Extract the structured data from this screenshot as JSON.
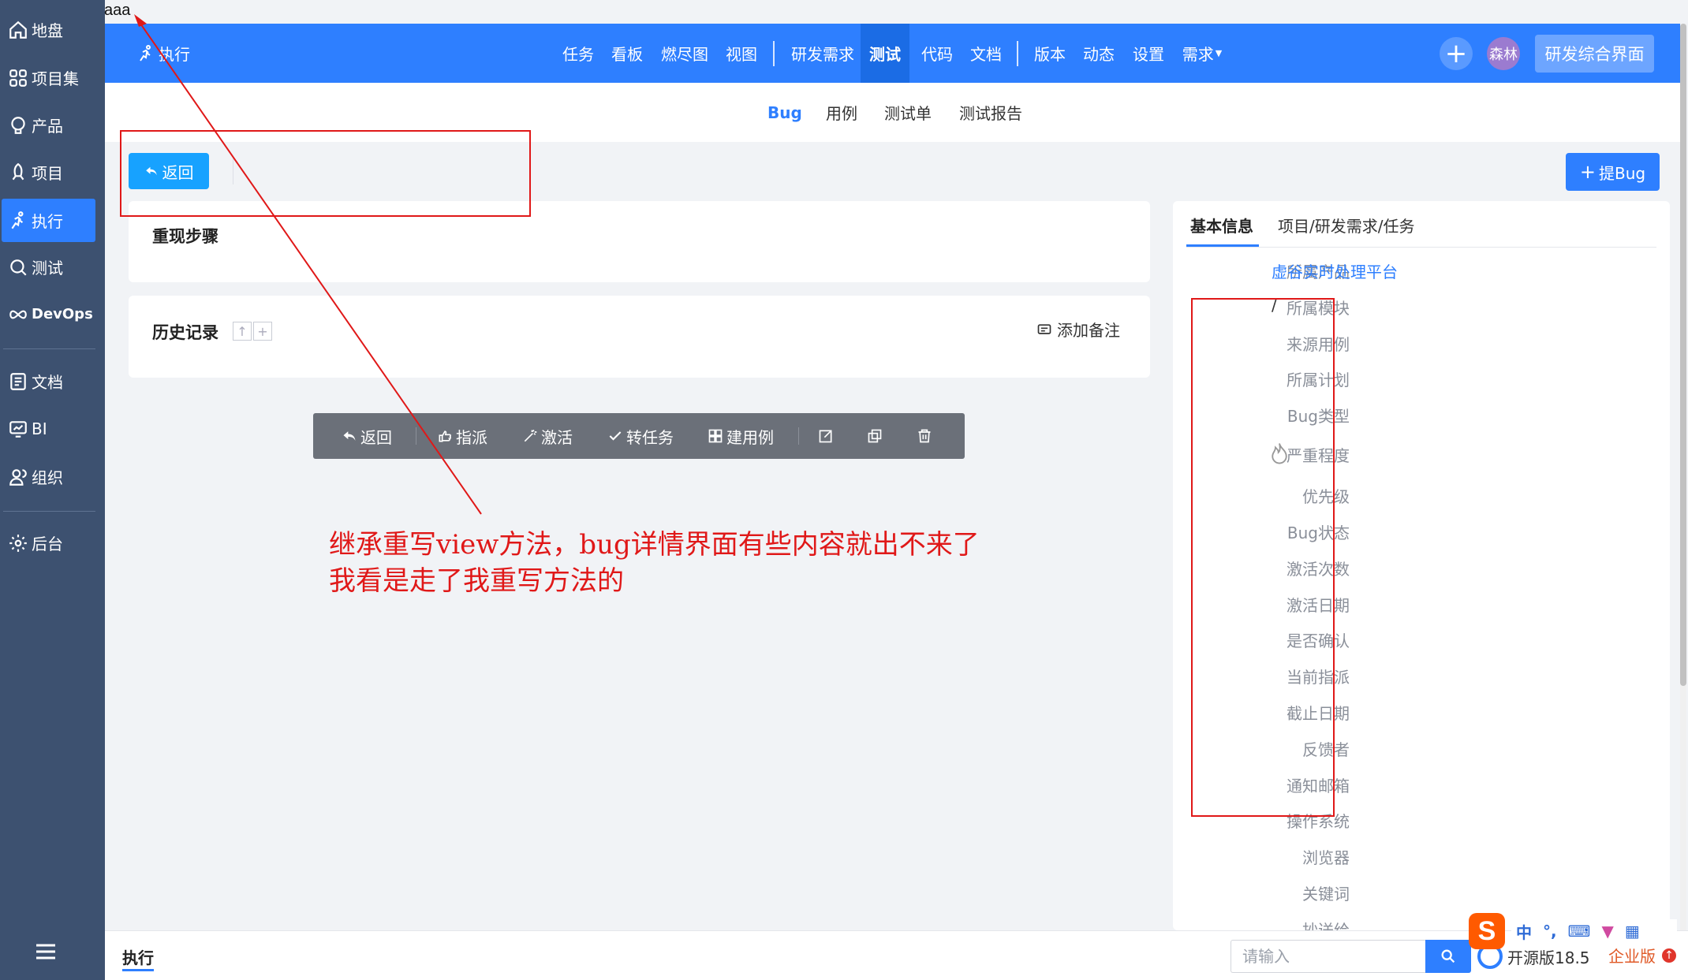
{
  "top_note": "aaa",
  "sidebar": {
    "items": [
      {
        "label": "地盘",
        "icon": "home-icon"
      },
      {
        "label": "项目集",
        "icon": "grid-icon"
      },
      {
        "label": "产品",
        "icon": "lightbulb-icon"
      },
      {
        "label": "项目",
        "icon": "rocket-icon"
      },
      {
        "label": "执行",
        "icon": "run-icon",
        "active": true
      },
      {
        "label": "测试",
        "icon": "magnifier-icon"
      },
      {
        "label": "DevOps",
        "icon": "infinity-icon"
      },
      {
        "label": "文档",
        "icon": "document-icon"
      },
      {
        "label": "BI",
        "icon": "chart-icon"
      },
      {
        "label": "组织",
        "icon": "people-icon"
      },
      {
        "label": "后台",
        "icon": "gear-icon"
      }
    ]
  },
  "header": {
    "module": "执行",
    "nav": [
      "任务",
      "看板",
      "燃尽图",
      "视图",
      "研发需求",
      "测试",
      "代码",
      "文档",
      "版本",
      "动态",
      "设置",
      "需求"
    ],
    "active_nav": "测试",
    "avatar": "森林",
    "workspace_button": "研发综合界面",
    "colors": {
      "header": "#2e7fff",
      "active": "#1b6ce5"
    }
  },
  "subnav": {
    "items": [
      "Bug",
      "用例",
      "测试单",
      "测试报告"
    ],
    "active": "Bug"
  },
  "toolbar": {
    "back": "返回",
    "report_bug": "提Bug"
  },
  "steps_panel": {
    "title": "重现步骤"
  },
  "history_panel": {
    "title": "历史记录",
    "add_note": "添加备注"
  },
  "action_bar": {
    "items": [
      {
        "label": "返回",
        "icon": "back-icon"
      },
      {
        "label": "指派",
        "icon": "hand-icon"
      },
      {
        "label": "激活",
        "icon": "magic-icon"
      },
      {
        "label": "转任务",
        "icon": "check-icon"
      },
      {
        "label": "建用例",
        "icon": "sitemap-icon"
      }
    ],
    "icon_buttons": [
      "edit-icon",
      "copy-icon",
      "trash-icon"
    ]
  },
  "info_panel": {
    "tabs": [
      "基本信息",
      "项目/研发需求/任务"
    ],
    "rows": [
      {
        "label": "所属产品",
        "value": "虚谷实时处理平台"
      },
      {
        "label": "所属模块",
        "value": "/"
      },
      {
        "label": "来源用例",
        "value": ""
      },
      {
        "label": "所属计划",
        "value": ""
      },
      {
        "label": "Bug类型",
        "value": ""
      },
      {
        "label": "严重程度",
        "value": ""
      },
      {
        "label": "优先级",
        "value": ""
      },
      {
        "label": "Bug状态",
        "value": ""
      },
      {
        "label": "激活次数",
        "value": ""
      },
      {
        "label": "激活日期",
        "value": ""
      },
      {
        "label": "是否确认",
        "value": ""
      },
      {
        "label": "当前指派",
        "value": ""
      },
      {
        "label": "截止日期",
        "value": ""
      },
      {
        "label": "反馈者",
        "value": ""
      },
      {
        "label": "通知邮箱",
        "value": ""
      },
      {
        "label": "操作系统",
        "value": ""
      },
      {
        "label": "浏览器",
        "value": ""
      },
      {
        "label": "关键词",
        "value": ""
      },
      {
        "label": "抄送给",
        "value": ""
      }
    ]
  },
  "bottom_bar": {
    "title": "执行",
    "search_placeholder": "请输入",
    "version": "开源版18.5",
    "edition": "企业版"
  },
  "ime": {
    "logo": "S",
    "mode": "中"
  },
  "annotation": {
    "lines": [
      "继承重写view方法，bug详情界面有些内容就出不来了",
      "我看是走了我重写方法的"
    ],
    "color": "#e01818"
  }
}
